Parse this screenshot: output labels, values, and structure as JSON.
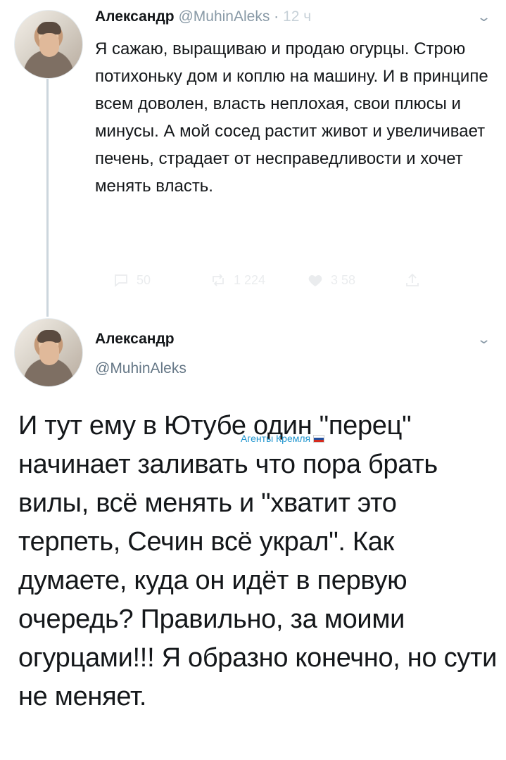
{
  "tweet1": {
    "author_name": "Александр",
    "handle": "@MuhinAleks",
    "separator": "·",
    "timestamp": "12 ч",
    "text": "Я сажаю, выращиваю и продаю огурцы. Строю потихоньку дом и коплю на машину. И в принципе всем доволен, власть неплохая, свои плюсы и минусы. А мой сосед растит живот и увеличивает печень, страдает от несправедливости и хочет менять власть.",
    "actions": {
      "replies": "50",
      "retweets": "1 224",
      "likes": "3 58"
    }
  },
  "tweet2": {
    "author_name": "Александр",
    "handle": "@MuhinAleks",
    "text": "И тут ему в Ютубе один \"перец\" начинает заливать что пора брать вилы, всё менять и \"хватит это терпеть, Сечин всё украл\". Как думаете, куда он идёт в первую очередь? Правильно, за моими огурцами!!! Я образно конечно, но сути не меняет."
  },
  "watermark": {
    "text": "Агенты Кремля"
  },
  "icons": {
    "chevron": "chevron-down-icon",
    "reply": "reply-icon",
    "retweet": "retweet-icon",
    "like": "heart-icon",
    "share": "share-icon"
  },
  "colors": {
    "handle": "#8899a6",
    "thread_line": "#ccd6dd",
    "watermark": "#1f95cf"
  }
}
